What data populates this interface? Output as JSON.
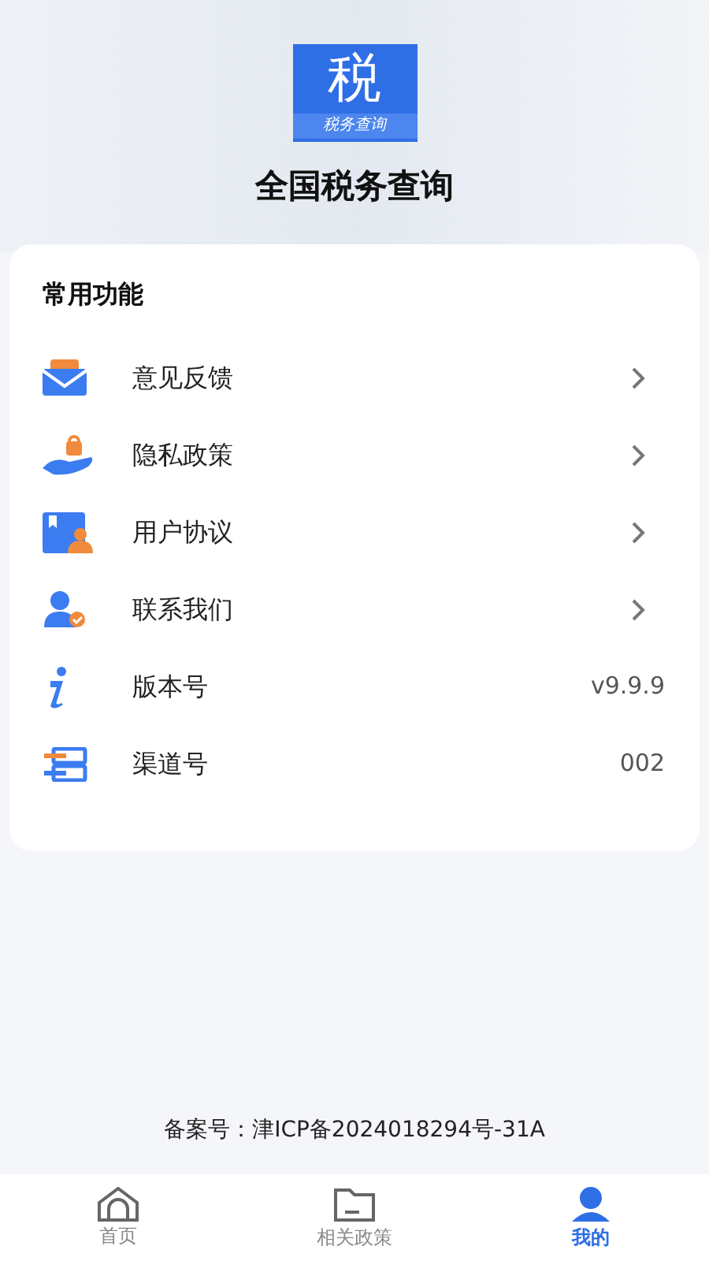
{
  "app": {
    "logo_char": "税",
    "logo_caption": "税务查询",
    "title": "全国税务查询"
  },
  "section": {
    "title": "常用功能",
    "items": [
      {
        "kind": "link",
        "label": "意见反馈"
      },
      {
        "kind": "link",
        "label": "隐私政策"
      },
      {
        "kind": "link",
        "label": "用户协议"
      },
      {
        "kind": "link",
        "label": "联系我们"
      },
      {
        "kind": "value",
        "label": "版本号",
        "value": "v9.9.9"
      },
      {
        "kind": "value",
        "label": "渠道号",
        "value": "002"
      }
    ]
  },
  "footer": {
    "record": "备案号：津ICP备2024018294号-31A"
  },
  "tabs": [
    {
      "label": "首页",
      "selected": false
    },
    {
      "label": "相关政策",
      "selected": false
    },
    {
      "label": "我的",
      "selected": true
    }
  ]
}
